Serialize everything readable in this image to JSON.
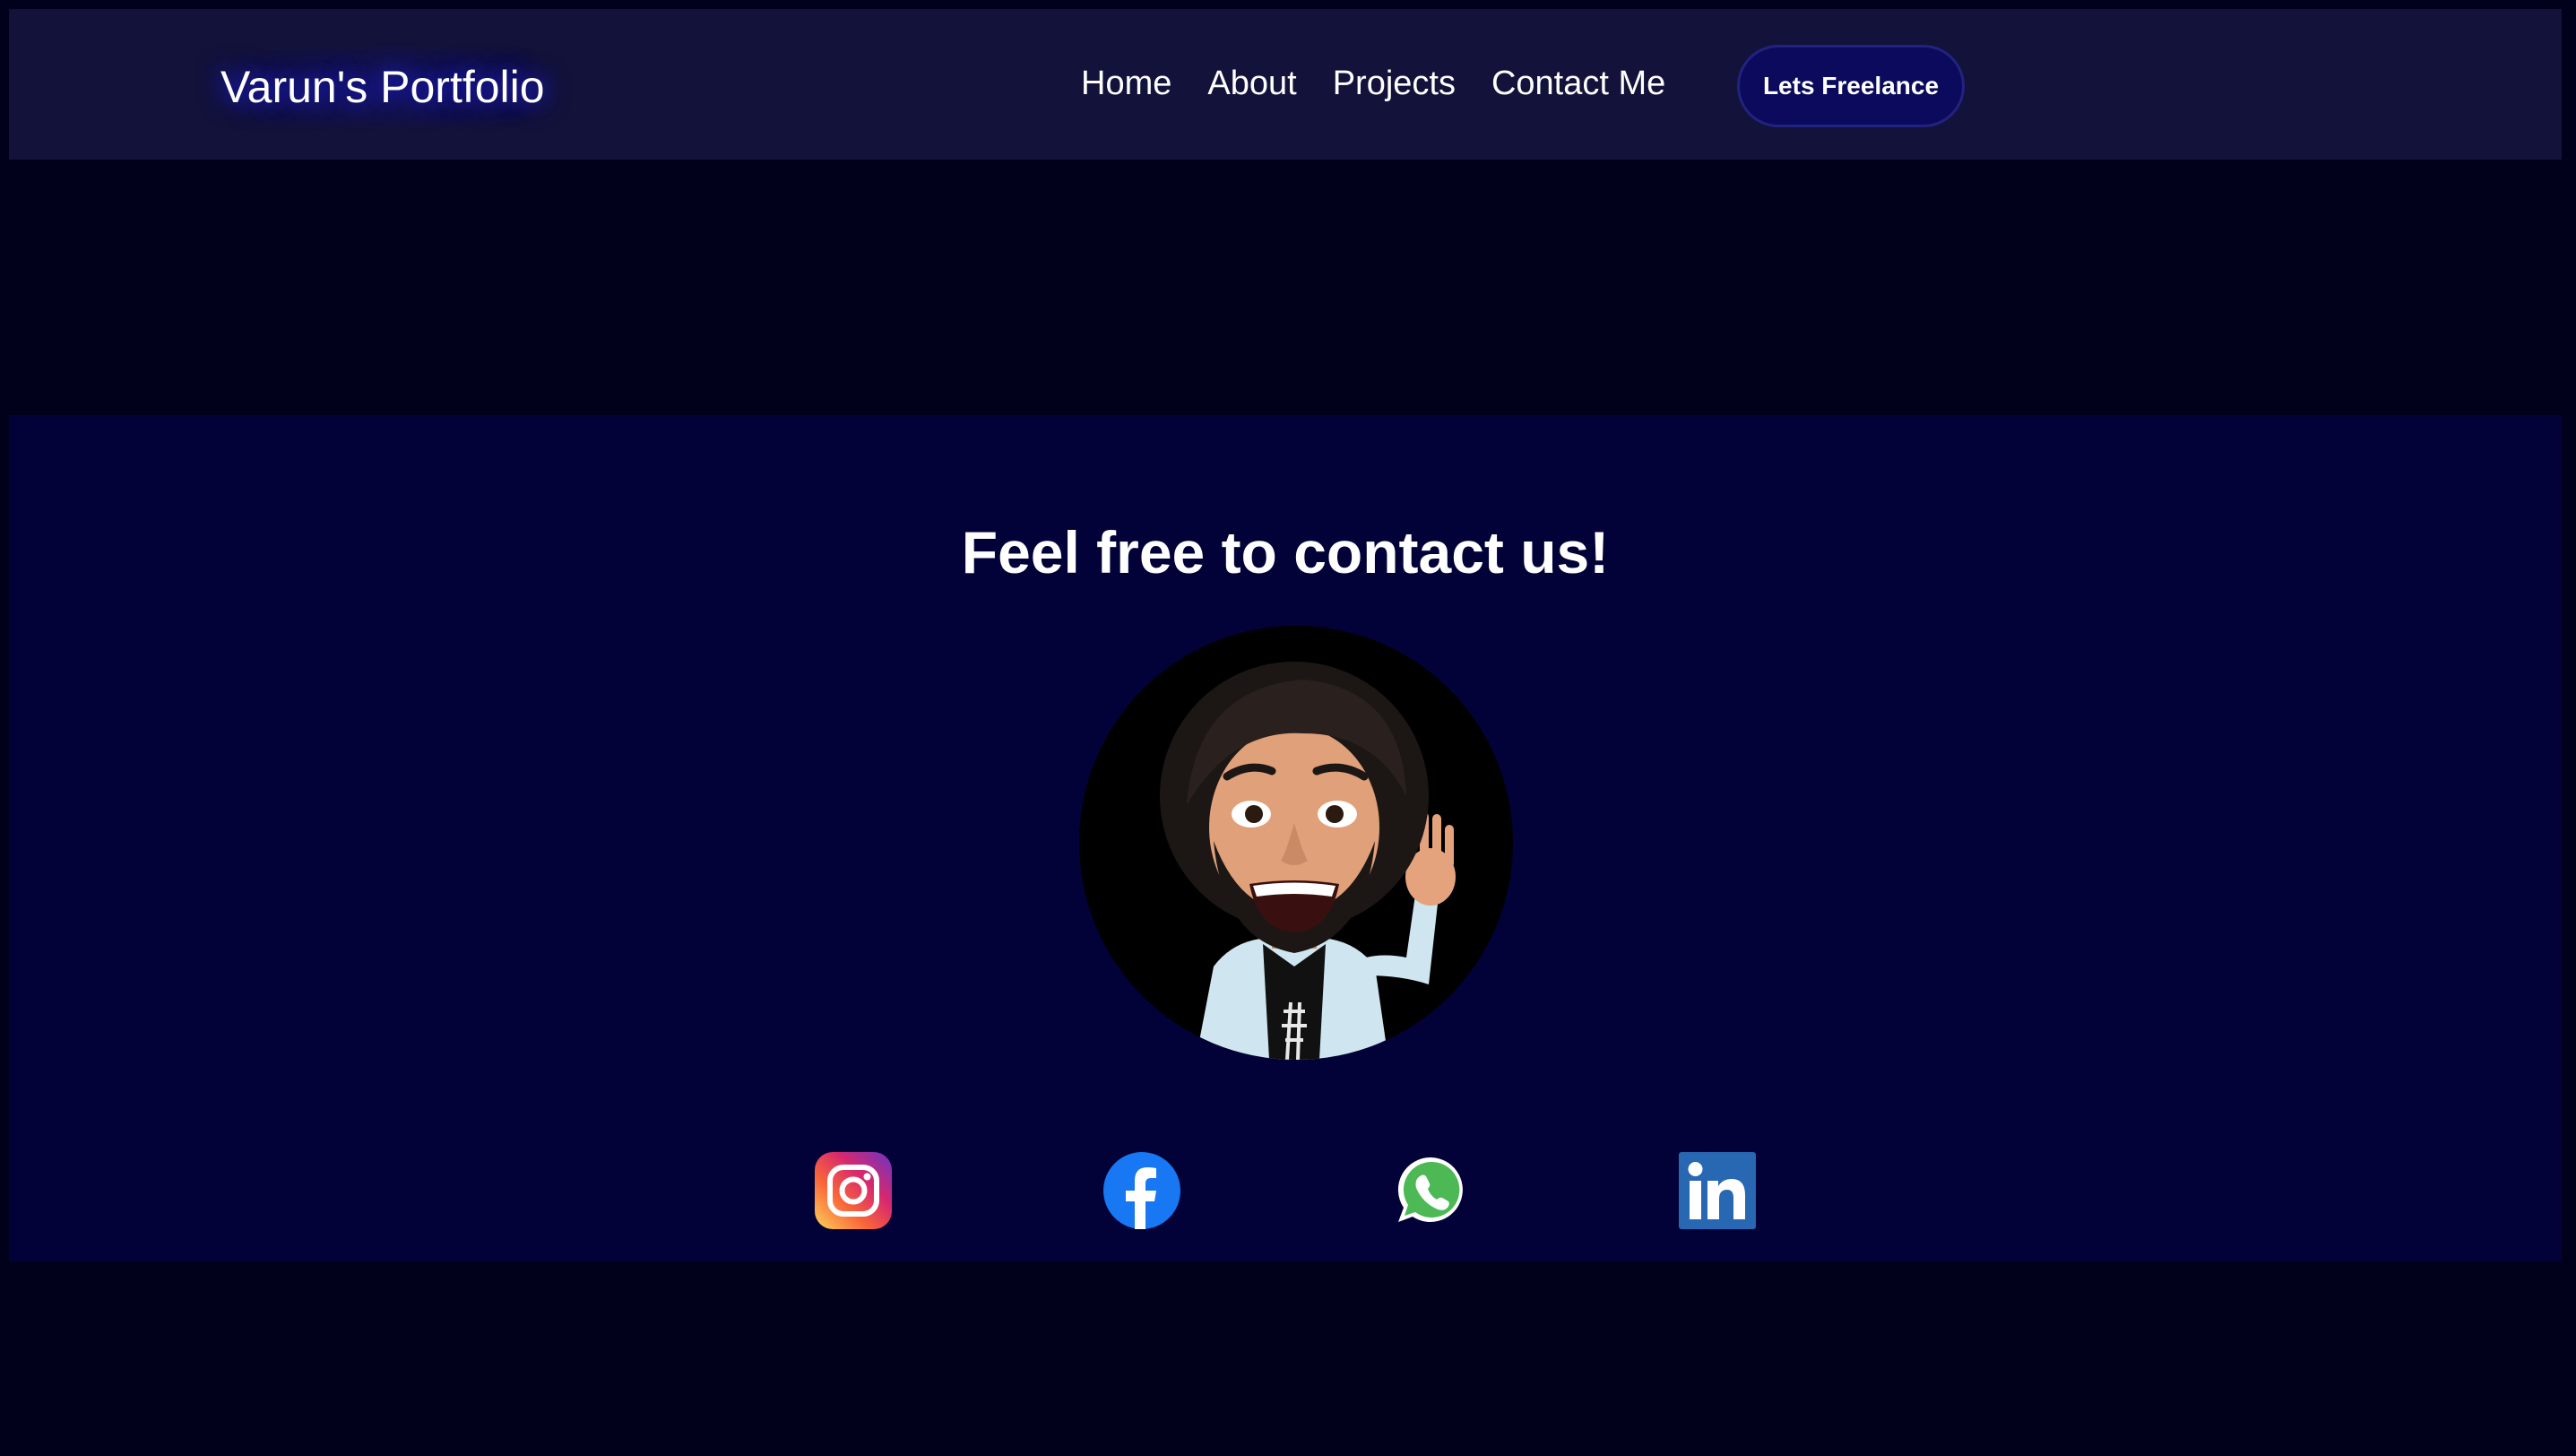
{
  "navbar": {
    "brand": "Varun's Portfolio",
    "links": [
      {
        "label": "Home"
      },
      {
        "label": "About"
      },
      {
        "label": "Projects"
      },
      {
        "label": "Contact Me"
      }
    ],
    "cta_label": "Lets Freelance"
  },
  "contact": {
    "title": "Feel free to contact us!",
    "socials": [
      {
        "icon": "instagram-icon"
      },
      {
        "icon": "facebook-icon"
      },
      {
        "icon": "whatsapp-icon"
      },
      {
        "icon": "linkedin-icon"
      }
    ]
  },
  "colors": {
    "page_background": "#01011c",
    "navbar_background": "#13123a",
    "section_background": "#020238",
    "button_background": "#0b0a5c",
    "text": "#ffffff"
  }
}
